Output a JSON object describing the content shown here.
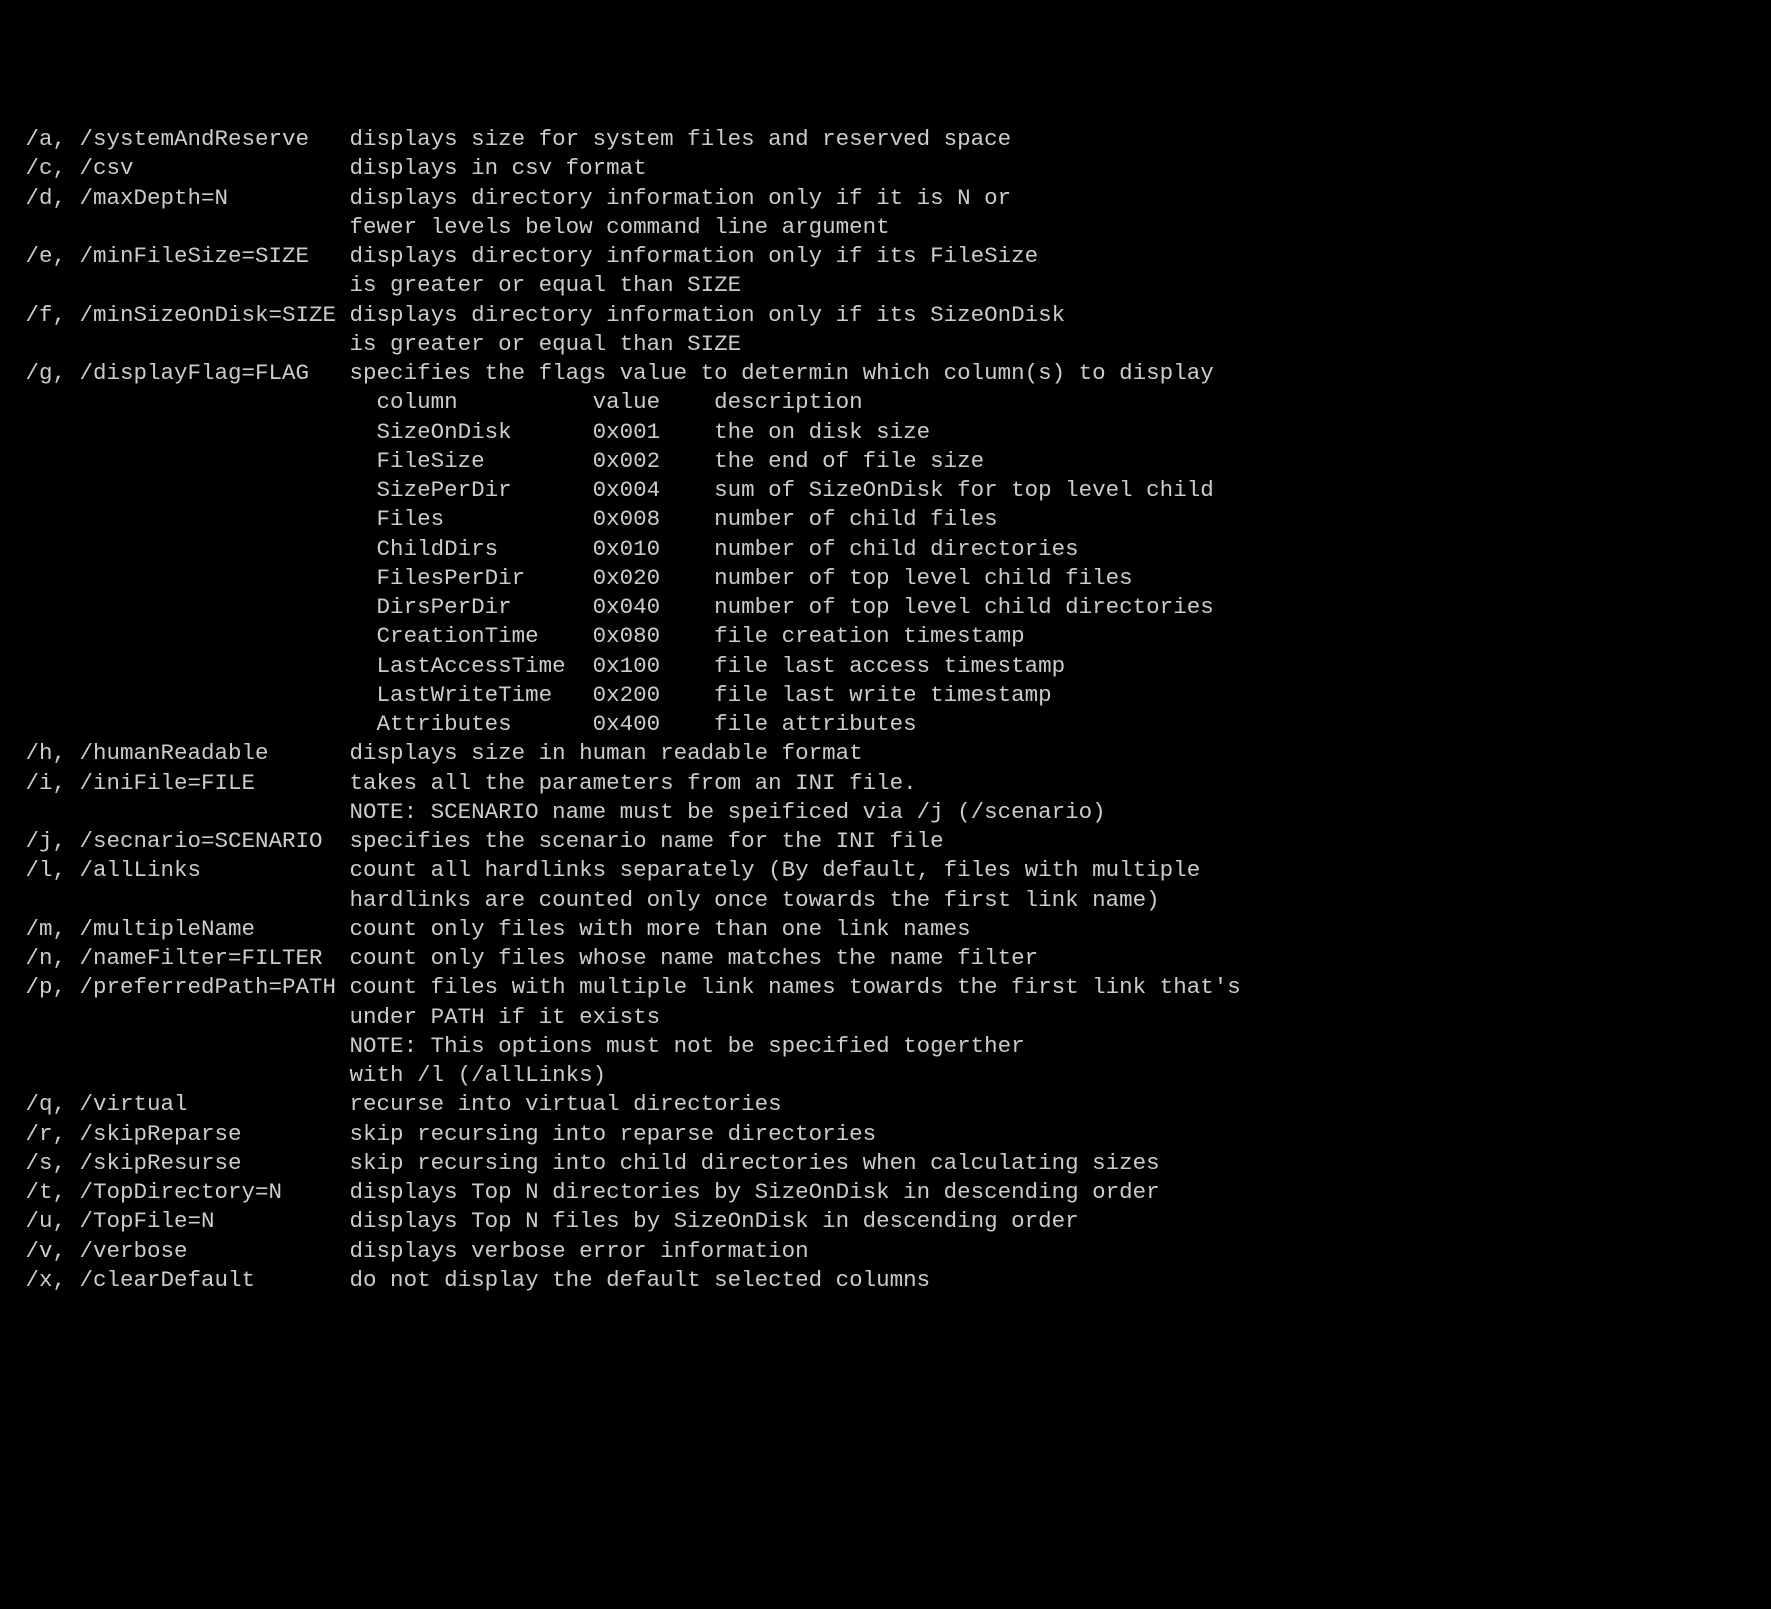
{
  "options": [
    {
      "flag": "/a, /systemAndReserve",
      "desc": [
        "displays size for system files and reserved space"
      ]
    },
    {
      "flag": "/c, /csv",
      "desc": [
        "displays in csv format"
      ]
    },
    {
      "flag": "/d, /maxDepth=N",
      "desc": [
        "displays directory information only if it is N or",
        "fewer levels below command line argument"
      ]
    },
    {
      "flag": "/e, /minFileSize=SIZE",
      "desc": [
        "displays directory information only if its FileSize",
        "is greater or equal than SIZE"
      ]
    },
    {
      "flag": "/f, /minSizeOnDisk=SIZE",
      "desc": [
        "displays directory information only if its SizeOnDisk",
        "is greater or equal than SIZE"
      ]
    },
    {
      "flag": "/g, /displayFlag=FLAG",
      "desc": [
        "specifies the flags value to determin which column(s) to display"
      ]
    },
    {
      "flag": "/h, /humanReadable",
      "desc": [
        "displays size in human readable format"
      ]
    },
    {
      "flag": "/i, /iniFile=FILE",
      "desc": [
        "takes all the parameters from an INI file.",
        "NOTE: SCENARIO name must be speificed via /j (/scenario)"
      ]
    },
    {
      "flag": "/j, /secnario=SCENARIO",
      "desc": [
        "specifies the scenario name for the INI file"
      ]
    },
    {
      "flag": "/l, /allLinks",
      "desc": [
        "count all hardlinks separately (By default, files with multiple",
        "hardlinks are counted only once towards the first link name)"
      ]
    },
    {
      "flag": "/m, /multipleName",
      "desc": [
        "count only files with more than one link names"
      ]
    },
    {
      "flag": "/n, /nameFilter=FILTER",
      "desc": [
        "count only files whose name matches the name filter"
      ]
    },
    {
      "flag": "/p, /preferredPath=PATH",
      "desc": [
        "count files with multiple link names towards the first link that's",
        "under PATH if it exists",
        "NOTE: This options must not be specified togerther",
        "with /l (/allLinks)"
      ]
    },
    {
      "flag": "/q, /virtual",
      "desc": [
        "recurse into virtual directories"
      ]
    },
    {
      "flag": "/r, /skipReparse",
      "desc": [
        "skip recursing into reparse directories"
      ]
    },
    {
      "flag": "/s, /skipResurse",
      "desc": [
        "skip recursing into child directories when calculating sizes"
      ]
    },
    {
      "flag": "/t, /TopDirectory=N",
      "desc": [
        "displays Top N directories by SizeOnDisk in descending order"
      ]
    },
    {
      "flag": "/u, /TopFile=N",
      "desc": [
        "displays Top N files by SizeOnDisk in descending order"
      ]
    },
    {
      "flag": "/v, /verbose",
      "desc": [
        "displays verbose error information"
      ]
    },
    {
      "flag": "/x, /clearDefault",
      "desc": [
        "do not display the default selected columns"
      ]
    }
  ],
  "flagTable": {
    "header": {
      "col1": "column",
      "col2": "value",
      "col3": "description"
    },
    "rows": [
      {
        "col1": "SizeOnDisk",
        "col2": "0x001",
        "col3": "the on disk size"
      },
      {
        "col1": "FileSize",
        "col2": "0x002",
        "col3": "the end of file size"
      },
      {
        "col1": "SizePerDir",
        "col2": "0x004",
        "col3": "sum of SizeOnDisk for top level child"
      },
      {
        "col1": "Files",
        "col2": "0x008",
        "col3": "number of child files"
      },
      {
        "col1": "ChildDirs",
        "col2": "0x010",
        "col3": "number of child directories"
      },
      {
        "col1": "FilesPerDir",
        "col2": "0x020",
        "col3": "number of top level child files"
      },
      {
        "col1": "DirsPerDir",
        "col2": "0x040",
        "col3": "number of top level child directories"
      },
      {
        "col1": "CreationTime",
        "col2": "0x080",
        "col3": "file creation timestamp"
      },
      {
        "col1": "LastAccessTime",
        "col2": "0x100",
        "col3": "file last access timestamp"
      },
      {
        "col1": "LastWriteTime",
        "col2": "0x200",
        "col3": "file last write timestamp"
      },
      {
        "col1": "Attributes",
        "col2": "0x400",
        "col3": "file attributes"
      }
    ]
  },
  "layout": {
    "leftPad": " ",
    "flagWidth": 24,
    "descIndent": "                         ",
    "tableIndent": "                           ",
    "tableCol1Width": 16,
    "tableCol2Width": 9
  }
}
